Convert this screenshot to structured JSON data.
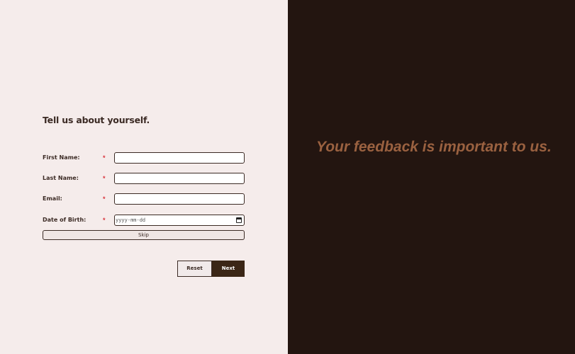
{
  "form": {
    "title": "Tell us about yourself.",
    "required_marker": "*",
    "fields": [
      {
        "label": "First Name:",
        "value": ""
      },
      {
        "label": "Last Name:",
        "value": ""
      },
      {
        "label": "Email:",
        "value": ""
      },
      {
        "label": "Date of Birth:",
        "placeholder": "yyyy-mm-dd"
      }
    ],
    "skip_label": "Skip",
    "reset_label": "Reset",
    "next_label": "Next"
  },
  "aside": {
    "tagline": "Your feedback is important to us."
  },
  "colors": {
    "left_background": "#f5eceb",
    "right_background": "#231510",
    "accent": "#3b2616",
    "tagline": "#9a6140",
    "required": "#d9343c"
  }
}
